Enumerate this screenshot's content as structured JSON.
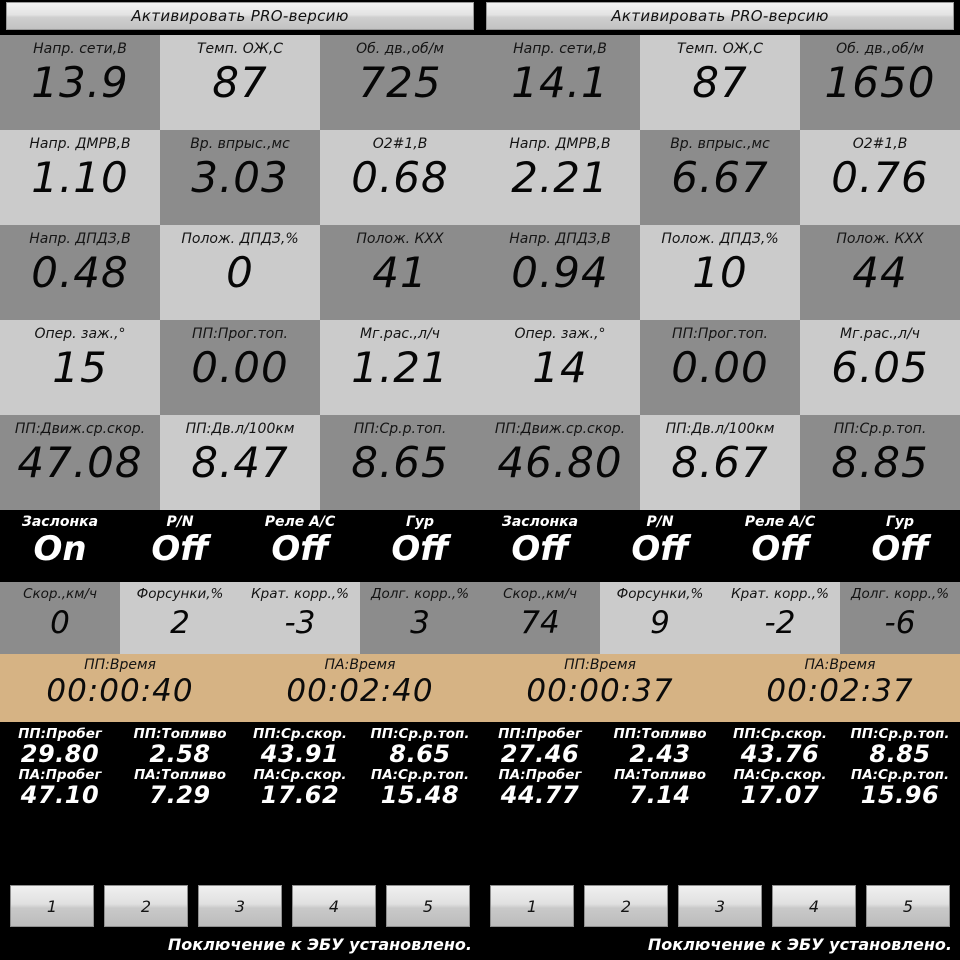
{
  "colors": {
    "cell_dark": "#8c8c8c",
    "cell_light": "#cbcbcb",
    "strip_black": "#000000",
    "timer_tan": "#d6b384",
    "text_dark": "#060606",
    "text_light": "#ffffff"
  },
  "panels": [
    {
      "id": "left",
      "banner": {
        "label": "Активировать PRO-версию"
      },
      "gauges": [
        {
          "label": "Напр. сети,В",
          "value": "13.9",
          "shade": "dk"
        },
        {
          "label": "Темп. ОЖ,С",
          "value": "87",
          "shade": "lt"
        },
        {
          "label": "Об. дв.,об/м",
          "value": "725",
          "shade": "dk"
        },
        {
          "label": "Напр. ДМРВ,В",
          "value": "1.10",
          "shade": "lt"
        },
        {
          "label": "Вр. впрыс.,мс",
          "value": "3.03",
          "shade": "dk"
        },
        {
          "label": "O2#1,В",
          "value": "0.68",
          "shade": "lt"
        },
        {
          "label": "Напр. ДПДЗ,В",
          "value": "0.48",
          "shade": "dk"
        },
        {
          "label": "Полож. ДПДЗ,%",
          "value": "0",
          "shade": "lt"
        },
        {
          "label": "Полож. КХХ",
          "value": "41",
          "shade": "dk"
        },
        {
          "label": "Опер. заж.,°",
          "value": "15",
          "shade": "lt"
        },
        {
          "label": "ПП:Прог.топ.",
          "value": "0.00",
          "shade": "dk"
        },
        {
          "label": "Мг.рас.,л/ч",
          "value": "1.21",
          "shade": "lt"
        },
        {
          "label": "ПП:Движ.ср.скор.",
          "value": "47.08",
          "shade": "dk"
        },
        {
          "label": "ПП:Дв.л/100км",
          "value": "8.47",
          "shade": "lt"
        },
        {
          "label": "ПП:Ср.р.топ.",
          "value": "8.65",
          "shade": "dk"
        }
      ],
      "switches": [
        {
          "label": "Заслонка",
          "value": "On"
        },
        {
          "label": "P/N",
          "value": "Off"
        },
        {
          "label": "Реле A/C",
          "value": "Off"
        },
        {
          "label": "Гур",
          "value": "Off"
        }
      ],
      "corrections": [
        {
          "label": "Скор.,км/ч",
          "value": "0"
        },
        {
          "label": "Форсунки,%",
          "value": "2"
        },
        {
          "label": "Крат. корр.,%",
          "value": "-3"
        },
        {
          "label": "Долг. корр.,%",
          "value": "3"
        }
      ],
      "timers": [
        {
          "label": "ПП:Время",
          "value": "00:00:40"
        },
        {
          "label": "ПА:Время",
          "value": "00:02:40"
        }
      ],
      "trip_rows": [
        [
          {
            "label": "ПП:Пробег",
            "value": "29.80"
          },
          {
            "label": "ПП:Топливо",
            "value": "2.58"
          },
          {
            "label": "ПП:Ср.скор.",
            "value": "43.91"
          },
          {
            "label": "ПП:Ср.р.топ.",
            "value": "8.65"
          }
        ],
        [
          {
            "label": "ПА:Пробег",
            "value": "47.10"
          },
          {
            "label": "ПА:Топливо",
            "value": "7.29"
          },
          {
            "label": "ПА:Ср.скор.",
            "value": "17.62"
          },
          {
            "label": "ПА:Ср.р.топ.",
            "value": "15.48"
          }
        ]
      ],
      "buttons": [
        "1",
        "2",
        "3",
        "4",
        "5"
      ],
      "status": "Поключение к ЭБУ установлено."
    },
    {
      "id": "right",
      "banner": {
        "label": "Активировать PRO-версию"
      },
      "gauges": [
        {
          "label": "Напр. сети,В",
          "value": "14.1",
          "shade": "dk"
        },
        {
          "label": "Темп. ОЖ,С",
          "value": "87",
          "shade": "lt"
        },
        {
          "label": "Об. дв.,об/м",
          "value": "1650",
          "shade": "dk"
        },
        {
          "label": "Напр. ДМРВ,В",
          "value": "2.21",
          "shade": "lt"
        },
        {
          "label": "Вр. впрыс.,мс",
          "value": "6.67",
          "shade": "dk"
        },
        {
          "label": "O2#1,В",
          "value": "0.76",
          "shade": "lt"
        },
        {
          "label": "Напр. ДПДЗ,В",
          "value": "0.94",
          "shade": "dk"
        },
        {
          "label": "Полож. ДПДЗ,%",
          "value": "10",
          "shade": "lt"
        },
        {
          "label": "Полож. КХХ",
          "value": "44",
          "shade": "dk"
        },
        {
          "label": "Опер. заж.,°",
          "value": "14",
          "shade": "lt"
        },
        {
          "label": "ПП:Прог.топ.",
          "value": "0.00",
          "shade": "dk"
        },
        {
          "label": "Мг.рас.,л/ч",
          "value": "6.05",
          "shade": "lt"
        },
        {
          "label": "ПП:Движ.ср.скор.",
          "value": "46.80",
          "shade": "dk"
        },
        {
          "label": "ПП:Дв.л/100км",
          "value": "8.67",
          "shade": "lt"
        },
        {
          "label": "ПП:Ср.р.топ.",
          "value": "8.85",
          "shade": "dk"
        }
      ],
      "switches": [
        {
          "label": "Заслонка",
          "value": "Off"
        },
        {
          "label": "P/N",
          "value": "Off"
        },
        {
          "label": "Реле A/C",
          "value": "Off"
        },
        {
          "label": "Гур",
          "value": "Off"
        }
      ],
      "corrections": [
        {
          "label": "Скор.,км/ч",
          "value": "74"
        },
        {
          "label": "Форсунки,%",
          "value": "9"
        },
        {
          "label": "Крат. корр.,%",
          "value": "-2"
        },
        {
          "label": "Долг. корр.,%",
          "value": "-6"
        }
      ],
      "timers": [
        {
          "label": "ПП:Время",
          "value": "00:00:37"
        },
        {
          "label": "ПА:Время",
          "value": "00:02:37"
        }
      ],
      "trip_rows": [
        [
          {
            "label": "ПП:Пробег",
            "value": "27.46"
          },
          {
            "label": "ПП:Топливо",
            "value": "2.43"
          },
          {
            "label": "ПП:Ср.скор.",
            "value": "43.76"
          },
          {
            "label": "ПП:Ср.р.топ.",
            "value": "8.85"
          }
        ],
        [
          {
            "label": "ПА:Пробег",
            "value": "44.77"
          },
          {
            "label": "ПА:Топливо",
            "value": "7.14"
          },
          {
            "label": "ПА:Ср.скор.",
            "value": "17.07"
          },
          {
            "label": "ПА:Ср.р.топ.",
            "value": "15.96"
          }
        ]
      ],
      "buttons": [
        "1",
        "2",
        "3",
        "4",
        "5"
      ],
      "status": "Поключение к ЭБУ установлено."
    }
  ]
}
